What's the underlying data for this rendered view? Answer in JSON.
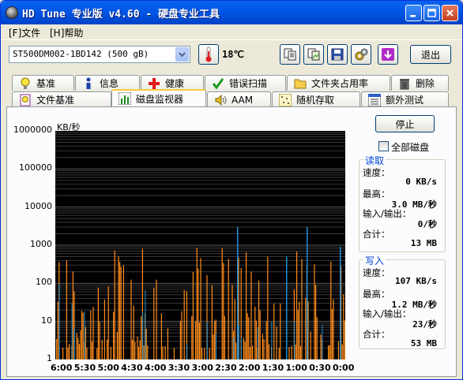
{
  "window": {
    "title": "HD Tune 专业版 v4.60 - 硬盘专业工具"
  },
  "menu": {
    "file": "[F]文件",
    "help": "[H]帮助"
  },
  "toolbar": {
    "drive": "ST500DM002-1BD142 (500 gB)",
    "temperature": "18℃",
    "exit_label": "退出"
  },
  "tabs_row1": [
    "基准",
    "信息",
    "健康",
    "错误扫描",
    "文件夹占用率",
    "删除"
  ],
  "tabs_row2": [
    "文件基准",
    "磁盘监视器",
    "AAM",
    "随机存取",
    "额外测试"
  ],
  "active_tab": "磁盘监视器",
  "monitor": {
    "stop_label": "停止",
    "all_disks_label": "全部磁盘",
    "read": {
      "title": "读取",
      "speed_label": "速度：",
      "speed": "0 KB/s",
      "peak_label": "最高：",
      "peak": "3.0 MB/秒",
      "io_label": "输入/输出：",
      "io": "0/秒",
      "total_label": "合计：",
      "total": "13 MB"
    },
    "write": {
      "title": "写入",
      "speed_label": "速度：",
      "speed": "107 KB/s",
      "peak_label": "最高：",
      "peak": "1.2 MB/秒",
      "io_label": "输入/输出：",
      "io": "23/秒",
      "total_label": "合计：",
      "total": "53 MB"
    }
  },
  "chart_data": {
    "type": "bar",
    "ylabel": "KB/秒",
    "yscale": "log",
    "ylim": [
      1,
      1000000
    ],
    "yticks": [
      "1000000",
      "100000",
      "10000",
      "1000",
      "100",
      "10",
      "1"
    ],
    "xticks": [
      "6:00",
      "5:30",
      "5:00",
      "4:30",
      "4:00",
      "3:30",
      "3:00",
      "2:30",
      "2:00",
      "1:30",
      "1:00",
      "0:30",
      "0:00"
    ],
    "series": [
      {
        "color": "#FF8C1A"
      },
      {
        "color": "#1E90D8"
      }
    ],
    "grid": true
  }
}
